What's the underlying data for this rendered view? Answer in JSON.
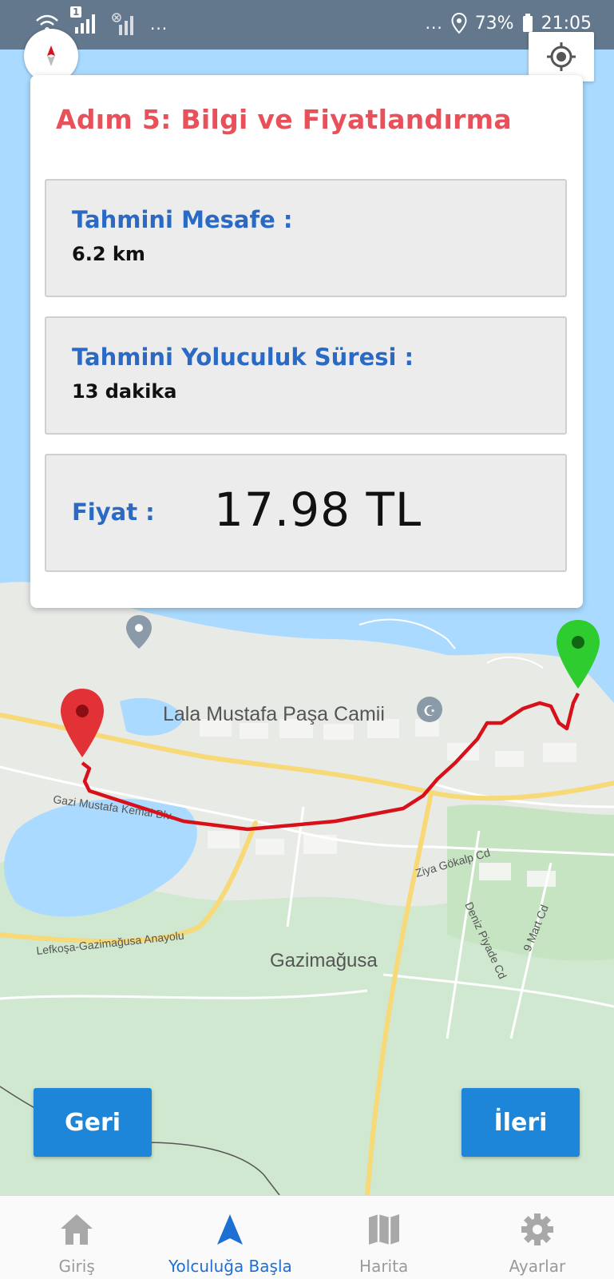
{
  "status_bar": {
    "battery": "73%",
    "time": "21:05",
    "sim_badge": "1",
    "overflow_left": "...",
    "overflow_right": "..."
  },
  "map": {
    "labels": {
      "mosque": "Lala Mustafa Paşa Camii",
      "boulevard": "Gazi Mustafa Kemal Blv.",
      "highway": "Lefkoşa-Gazimağusa Anayolu",
      "city": "Gazimağusa",
      "street1": "Ziya Gökalp Cd",
      "street2": "Deniz Piyade Cd",
      "street3": "9 Mart Cd"
    }
  },
  "card": {
    "title": "Adım 5: Bilgi ve Fiyatlandırma",
    "distance": {
      "label": "Tahmini Mesafe :",
      "value": "6.2 km"
    },
    "duration": {
      "label": "Tahmini Yoluculuk Süresi :",
      "value": "13 dakika"
    },
    "price": {
      "label": "Fiyat :",
      "value": "17.98 TL"
    }
  },
  "buttons": {
    "back": "Geri",
    "next": "İleri"
  },
  "nav": [
    {
      "label": "Giriş",
      "icon": "home-icon"
    },
    {
      "label": "Yolculuğa Başla",
      "icon": "navigation-arrow-icon",
      "active": true
    },
    {
      "label": "Harita",
      "icon": "map-icon"
    },
    {
      "label": "Ayarlar",
      "icon": "gear-icon"
    }
  ],
  "colors": {
    "title": "#e8515a",
    "label": "#2a6ac4",
    "button": "#1e86d8",
    "nav_active": "#1e6fd4",
    "route": "#d8101a",
    "origin_pin": "#e33236",
    "destination_pin": "#2ecc2e"
  }
}
